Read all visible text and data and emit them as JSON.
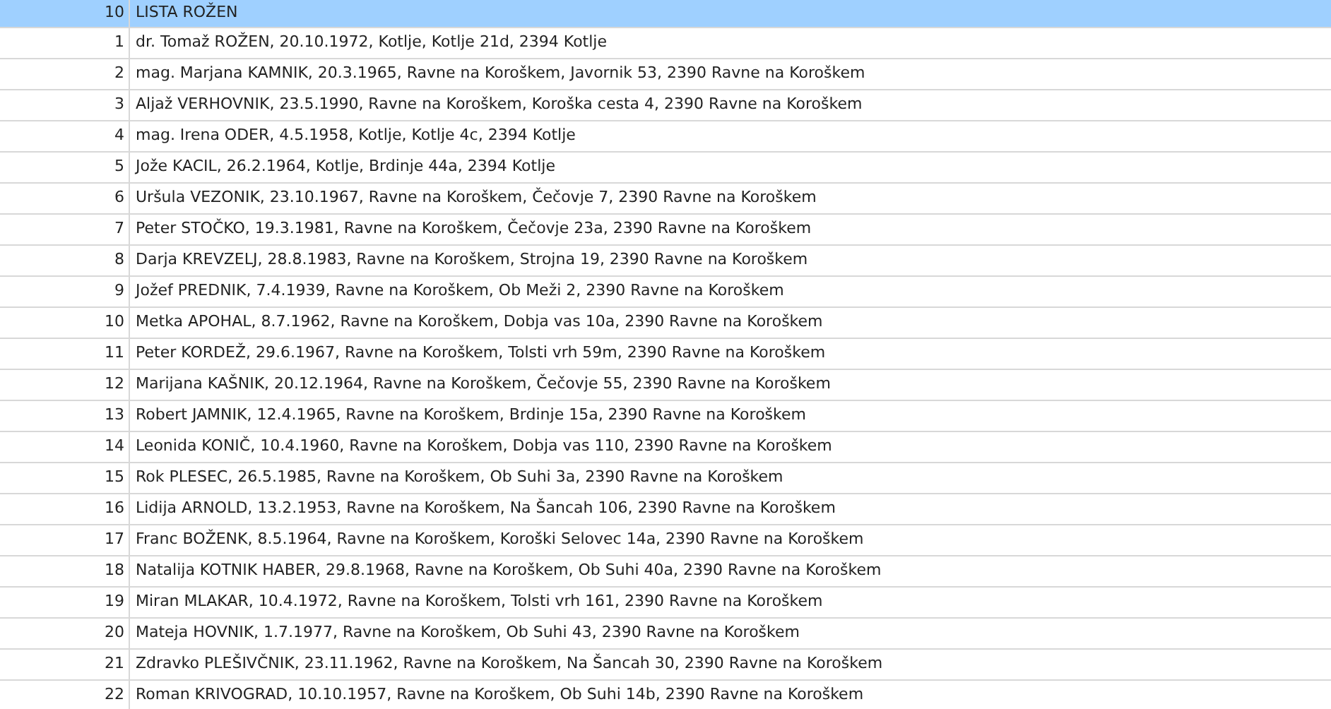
{
  "list": {
    "number": "10",
    "title": "LISTA ROŽEN",
    "selected": true
  },
  "rows": [
    {
      "number": "1",
      "text": "dr. Tomaž ROŽEN, 20.10.1972, Kotlje, Kotlje 21d, 2394 Kotlje",
      "selected": false
    },
    {
      "number": "2",
      "text": "mag. Marjana KAMNIK, 20.3.1965, Ravne na Koroškem, Javornik 53, 2390 Ravne na Koroškem",
      "selected": false
    },
    {
      "number": "3",
      "text": "Aljaž VERHOVNIK, 23.5.1990, Ravne na Koroškem, Koroška cesta 4, 2390 Ravne na Koroškem",
      "selected": false
    },
    {
      "number": "4",
      "text": "mag. Irena ODER, 4.5.1958, Kotlje, Kotlje 4c, 2394 Kotlje",
      "selected": false
    },
    {
      "number": "5",
      "text": "Jože KACIL, 26.2.1964, Kotlje, Brdinje 44a, 2394 Kotlje",
      "selected": false
    },
    {
      "number": "6",
      "text": "Uršula VEZONIK, 23.10.1967, Ravne na Koroškem, Čečovje 7, 2390 Ravne na Koroškem",
      "selected": false
    },
    {
      "number": "7",
      "text": "Peter STOČKO, 19.3.1981, Ravne na Koroškem, Čečovje 23a, 2390 Ravne na Koroškem",
      "selected": false
    },
    {
      "number": "8",
      "text": "Darja KREVZELJ, 28.8.1983, Ravne na Koroškem, Strojna 19, 2390 Ravne na Koroškem",
      "selected": false
    },
    {
      "number": "9",
      "text": "Jožef PREDNIK, 7.4.1939, Ravne na Koroškem, Ob Meži 2, 2390 Ravne na Koroškem",
      "selected": false
    },
    {
      "number": "10",
      "text": "Metka APOHAL, 8.7.1962, Ravne na Koroškem, Dobja vas 10a, 2390 Ravne na Koroškem",
      "selected": false
    },
    {
      "number": "11",
      "text": "Peter KORDEŽ, 29.6.1967, Ravne na Koroškem, Tolsti vrh 59m, 2390 Ravne na Koroškem",
      "selected": false
    },
    {
      "number": "12",
      "text": "Marijana KAŠNIK, 20.12.1964, Ravne na Koroškem, Čečovje 55, 2390 Ravne na Koroškem",
      "selected": false
    },
    {
      "number": "13",
      "text": "Robert JAMNIK, 12.4.1965, Ravne na Koroškem, Brdinje 15a, 2390 Ravne na Koroškem",
      "selected": false
    },
    {
      "number": "14",
      "text": "Leonida KONIČ, 10.4.1960, Ravne na Koroškem, Dobja vas 110, 2390 Ravne na Koroškem",
      "selected": false
    },
    {
      "number": "15",
      "text": "Rok PLESEC, 26.5.1985, Ravne na Koroškem, Ob Suhi 3a, 2390 Ravne na Koroškem",
      "selected": false
    },
    {
      "number": "16",
      "text": "Lidija ARNOLD, 13.2.1953, Ravne na Koroškem, Na Šancah 106, 2390 Ravne na Koroškem",
      "selected": false
    },
    {
      "number": "17",
      "text": "Franc BOŽENK, 8.5.1964, Ravne na Koroškem, Koroški Selovec 14a, 2390 Ravne na Koroškem",
      "selected": false
    },
    {
      "number": "18",
      "text": "Natalija KOTNIK HABER, 29.8.1968, Ravne na Koroškem, Ob Suhi 40a, 2390 Ravne na Koroškem",
      "selected": false
    },
    {
      "number": "19",
      "text": "Miran MLAKAR, 10.4.1972, Ravne na Koroškem, Tolsti vrh 161, 2390 Ravne na Koroškem",
      "selected": false
    },
    {
      "number": "20",
      "text": "Mateja HOVNIK, 1.7.1977, Ravne na Koroškem, Ob Suhi 43, 2390 Ravne na Koroškem",
      "selected": false
    },
    {
      "number": "21",
      "text": "Zdravko PLEŠIVČNIK, 23.11.1962, Ravne na Koroškem, Na Šancah 30, 2390 Ravne na Koroškem",
      "selected": false
    },
    {
      "number": "22",
      "text": "Roman KRIVOGRAD, 10.10.1957, Ravne na Koroškem, Ob Suhi 14b, 2390 Ravne na Koroškem",
      "selected": false
    }
  ]
}
